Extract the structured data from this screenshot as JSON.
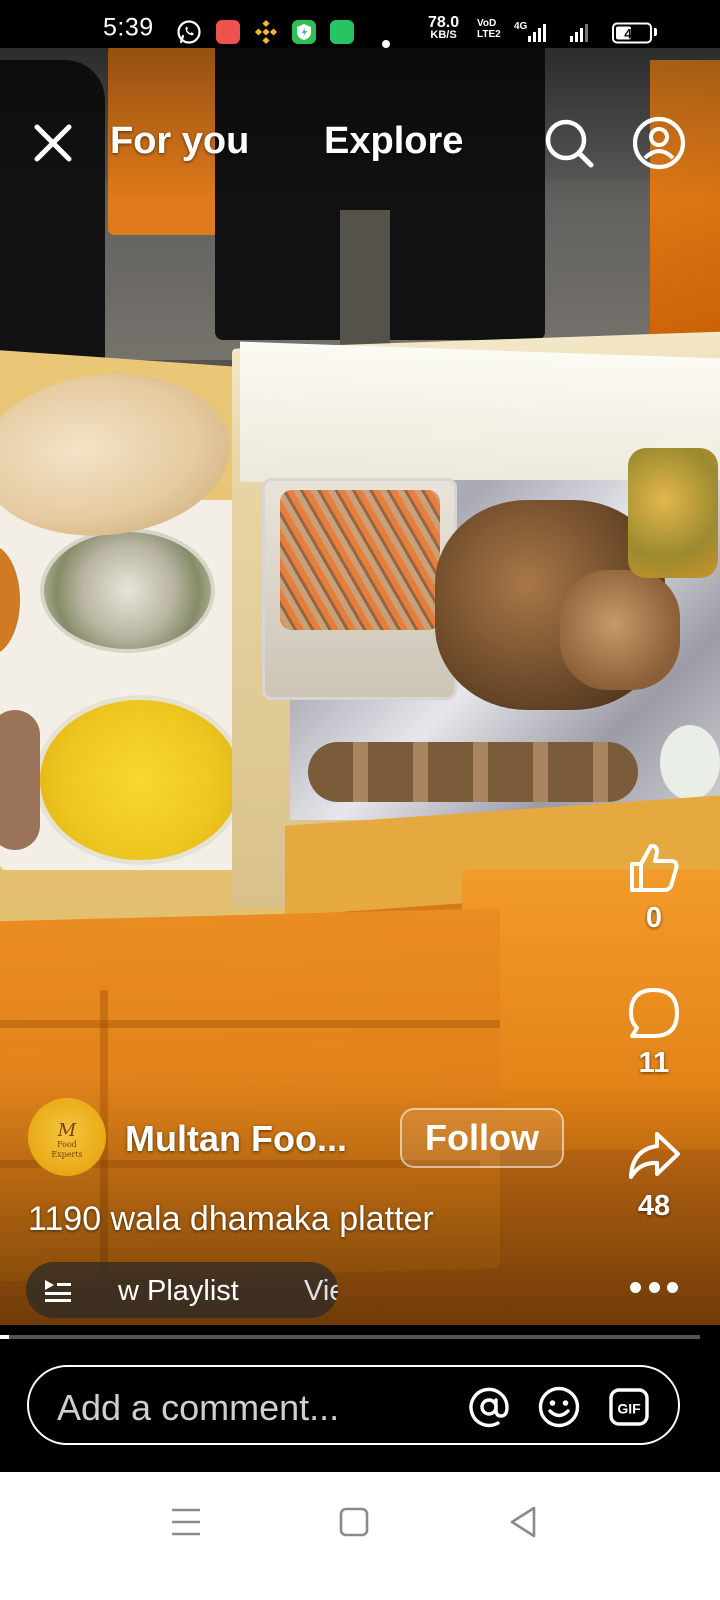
{
  "status_bar": {
    "time": "5:39",
    "net_speed_value": "78.0",
    "net_speed_unit": "KB/S",
    "volte_line1": "VoD",
    "volte_line2": "LTE2",
    "network_type": "4G",
    "battery": "41",
    "battery_level": 0.41,
    "icons": [
      "whatsapp-icon",
      "recorder-app-icon",
      "binance-icon",
      "vpn-shield-icon",
      "green-app-icon",
      "notification-dot"
    ]
  },
  "top_nav": {
    "tabs": [
      {
        "label": "For you"
      },
      {
        "label": "Explore"
      }
    ],
    "icons": [
      "close-icon",
      "search-icon",
      "profile-icon"
    ]
  },
  "actions": {
    "likes": "0",
    "comments": "11",
    "shares": "48",
    "icons": [
      "like-icon",
      "comment-icon",
      "share-icon",
      "more-icon"
    ]
  },
  "creator": {
    "name": "Multan Foo...",
    "avatar_text_line1": "M",
    "avatar_text_line2": "Food Experts",
    "follow_label": "Follow"
  },
  "caption": "1190 wala dhamaka platter",
  "playlist": {
    "label": "w Playlist",
    "views_label": "Vie"
  },
  "progress": 0.01,
  "comment_bar": {
    "placeholder": "Add a comment...",
    "icons": [
      "mention-icon",
      "emoji-icon",
      "gif-icon"
    ],
    "gif_label": "GIF"
  },
  "android_nav": {
    "icons": [
      "menu-icon",
      "home-icon",
      "back-icon"
    ]
  },
  "colors": {
    "background": "#000000",
    "text": "#ffffff",
    "android_nav_bg": "#ffffff",
    "android_nav_icon": "#8a8a8a"
  }
}
